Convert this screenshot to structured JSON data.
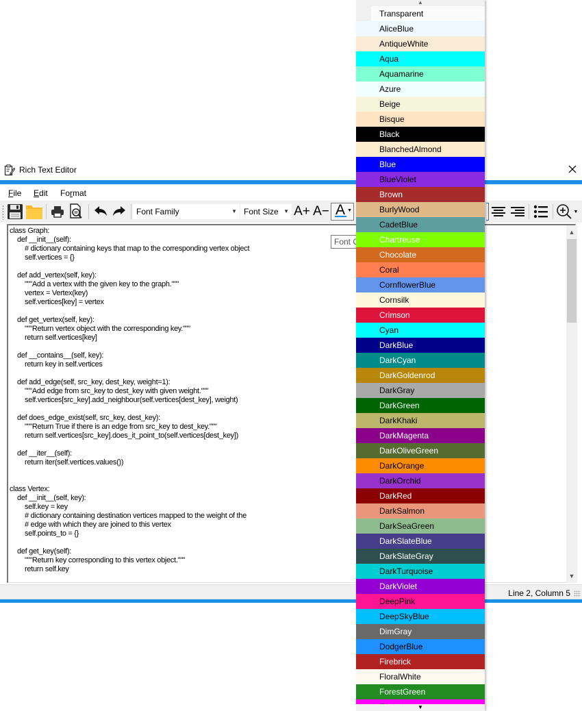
{
  "window": {
    "title": "Rich Text Editor",
    "icon": "notepad-pencil-icon",
    "close_icon": "close-icon"
  },
  "menu": [
    {
      "label": "File",
      "mnemonic": "F"
    },
    {
      "label": "Edit",
      "mnemonic": "E"
    },
    {
      "label": "Format",
      "mnemonic": "r"
    }
  ],
  "toolbar": {
    "buttons": [
      {
        "name": "save",
        "icon": "floppy-disk-icon"
      },
      {
        "name": "open",
        "icon": "folder-icon"
      },
      {
        "name": "print",
        "icon": "printer-icon"
      },
      {
        "name": "print-preview",
        "icon": "print-preview-icon"
      },
      {
        "name": "undo",
        "icon": "undo-arrow-icon"
      },
      {
        "name": "redo",
        "icon": "redo-arrow-icon"
      }
    ],
    "font_family": {
      "value": "Font Family"
    },
    "font_size": {
      "value": "Font Size"
    },
    "grow_font": "A+",
    "shrink_font": "A−",
    "font_color_glyph": "A",
    "font_color_accent": "#1e8fe6",
    "align_center_icon": "align-center-icon",
    "align_right_icon": "align-right-icon",
    "bullet_list_icon": "bullet-list-icon",
    "zoom_icon": "zoom-in-icon"
  },
  "tooltip": {
    "text": "Font Color"
  },
  "editor": {
    "lines": [
      "class Graph:",
      "    def __init__(self):",
      "        # dictionary containing keys that map to the corresponding vertex object",
      "        self.vertices = {}",
      "",
      "    def add_vertex(self, key):",
      "        \"\"\"Add a vertex with the given key to the graph.\"\"\"",
      "        vertex = Vertex(key)",
      "        self.vertices[key] = vertex",
      "",
      "    def get_vertex(self, key):",
      "        \"\"\"Return vertex object with the corresponding key.\"\"\"",
      "        return self.vertices[key]",
      "",
      "    def __contains__(self, key):",
      "        return key in self.vertices",
      "",
      "    def add_edge(self, src_key, dest_key, weight=1):",
      "        \"\"\"Add edge from src_key to dest_key with given weight.\"\"\"",
      "        self.vertices[src_key].add_neighbour(self.vertices[dest_key], weight)",
      "",
      "    def does_edge_exist(self, src_key, dest_key):",
      "        \"\"\"Return True if there is an edge from src_key to dest_key.\"\"\"",
      "        return self.vertices[src_key].does_it_point_to(self.vertices[dest_key])",
      "",
      "    def __iter__(self):",
      "        return iter(self.vertices.values())",
      "",
      "",
      "class Vertex:",
      "    def __init__(self, key):",
      "        self.key = key",
      "        # dictionary containing destination vertices mapped to the weight of the",
      "        # edge with which they are joined to this vertex",
      "        self.points_to = {}",
      "",
      "    def get_key(self):",
      "        \"\"\"Return key corresponding to this vertex object.\"\"\"",
      "        return self.key"
    ]
  },
  "status": {
    "position": "Line 2, Column 5"
  },
  "color_dropdown": {
    "scroll_up": "▲",
    "scroll_down": "▼",
    "items": [
      {
        "name": "Transparent",
        "bg": "transparent",
        "fg": "#000000"
      },
      {
        "name": "AliceBlue",
        "bg": "#F0F8FF",
        "fg": "#000000"
      },
      {
        "name": "AntiqueWhite",
        "bg": "#FAEBD7",
        "fg": "#000000"
      },
      {
        "name": "Aqua",
        "bg": "#00FFFF",
        "fg": "#000000"
      },
      {
        "name": "Aquamarine",
        "bg": "#7FFFD4",
        "fg": "#000000"
      },
      {
        "name": "Azure",
        "bg": "#F0FFFF",
        "fg": "#000000"
      },
      {
        "name": "Beige",
        "bg": "#F5F5DC",
        "fg": "#000000"
      },
      {
        "name": "Bisque",
        "bg": "#FFE4C4",
        "fg": "#000000"
      },
      {
        "name": "Black",
        "bg": "#000000",
        "fg": "#FFFFFF"
      },
      {
        "name": "BlanchedAlmond",
        "bg": "#FFEBCD",
        "fg": "#000000"
      },
      {
        "name": "Blue",
        "bg": "#0000FF",
        "fg": "#FFFFFF"
      },
      {
        "name": "BlueViolet",
        "bg": "#8A2BE2",
        "fg": "#000000"
      },
      {
        "name": "Brown",
        "bg": "#A52A2A",
        "fg": "#FFFFFF"
      },
      {
        "name": "BurlyWood",
        "bg": "#DEB887",
        "fg": "#000000"
      },
      {
        "name": "CadetBlue",
        "bg": "#5F9EA0",
        "fg": "#000000"
      },
      {
        "name": "Chartreuse",
        "bg": "#7FFF00",
        "fg": "#FFFFFF"
      },
      {
        "name": "Chocolate",
        "bg": "#D2691E",
        "fg": "#FFFFFF"
      },
      {
        "name": "Coral",
        "bg": "#FF7F50",
        "fg": "#000000"
      },
      {
        "name": "CornflowerBlue",
        "bg": "#6495ED",
        "fg": "#000000"
      },
      {
        "name": "Cornsilk",
        "bg": "#FFF8DC",
        "fg": "#000000"
      },
      {
        "name": "Crimson",
        "bg": "#DC143C",
        "fg": "#FFFFFF"
      },
      {
        "name": "Cyan",
        "bg": "#00FFFF",
        "fg": "#000000"
      },
      {
        "name": "DarkBlue",
        "bg": "#00008B",
        "fg": "#FFFFFF"
      },
      {
        "name": "DarkCyan",
        "bg": "#008B8B",
        "fg": "#FFFFFF"
      },
      {
        "name": "DarkGoldenrod",
        "bg": "#B8860B",
        "fg": "#FFFFFF"
      },
      {
        "name": "DarkGray",
        "bg": "#A9A9A9",
        "fg": "#000000"
      },
      {
        "name": "DarkGreen",
        "bg": "#006400",
        "fg": "#FFFFFF"
      },
      {
        "name": "DarkKhaki",
        "bg": "#BDB76B",
        "fg": "#000000"
      },
      {
        "name": "DarkMagenta",
        "bg": "#8B008B",
        "fg": "#FFFFFF"
      },
      {
        "name": "DarkOliveGreen",
        "bg": "#556B2F",
        "fg": "#FFFFFF"
      },
      {
        "name": "DarkOrange",
        "bg": "#FF8C00",
        "fg": "#000000"
      },
      {
        "name": "DarkOrchid",
        "bg": "#9932CC",
        "fg": "#000000"
      },
      {
        "name": "DarkRed",
        "bg": "#8B0000",
        "fg": "#FFFFFF"
      },
      {
        "name": "DarkSalmon",
        "bg": "#E9967A",
        "fg": "#000000"
      },
      {
        "name": "DarkSeaGreen",
        "bg": "#8FBC8F",
        "fg": "#000000"
      },
      {
        "name": "DarkSlateBlue",
        "bg": "#483D8B",
        "fg": "#FFFFFF"
      },
      {
        "name": "DarkSlateGray",
        "bg": "#2F4F4F",
        "fg": "#FFFFFF"
      },
      {
        "name": "DarkTurquoise",
        "bg": "#00CED1",
        "fg": "#000000"
      },
      {
        "name": "DarkViolet",
        "bg": "#9400D3",
        "fg": "#FFFFFF"
      },
      {
        "name": "DeepPink",
        "bg": "#FF1493",
        "fg": "#000000"
      },
      {
        "name": "DeepSkyBlue",
        "bg": "#00BFFF",
        "fg": "#000000"
      },
      {
        "name": "DimGray",
        "bg": "#696969",
        "fg": "#FFFFFF"
      },
      {
        "name": "DodgerBlue",
        "bg": "#1E90FF",
        "fg": "#000000"
      },
      {
        "name": "Firebrick",
        "bg": "#B22222",
        "fg": "#FFFFFF"
      },
      {
        "name": "FloralWhite",
        "bg": "#FFFAF0",
        "fg": "#000000"
      },
      {
        "name": "ForestGreen",
        "bg": "#228B22",
        "fg": "#FFFFFF"
      },
      {
        "name": "Fuchsia",
        "bg": "#FF00FF",
        "fg": "#000000"
      }
    ]
  }
}
